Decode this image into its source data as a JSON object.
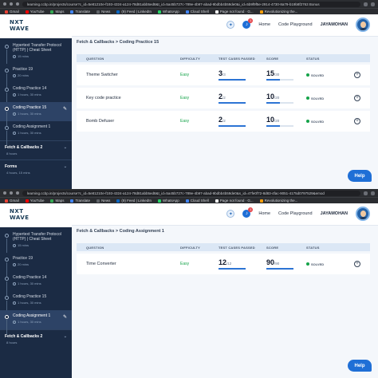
{
  "browser": {
    "url_top": "learning.ccbp.in/projects/course?c_id=5e81210e-f193-4324-a124-78d81abb5ed8&t_id=5a45b727c-789e-4b97-abad-9bdbb4b59de0&i_id=5b9f9f5e-2914-4730-8a79-b19b8f2763 Bonus",
    "url_bottom": "learning.ccbp.in/projects/course?c_id=5e81210e-f193-4324-a124-78d81abb5ed8&t_id=5a45b727c-789e-4b97-abad-9bdbb4b59de0&s_id=47fe0f72-8d83-4fac-9051-4175d0797529&emod",
    "bookmarks": [
      {
        "label": "Gmail",
        "color": "#ea4335"
      },
      {
        "label": "YouTube",
        "color": "#ff0000"
      },
      {
        "label": "Maps",
        "color": "#34a853"
      },
      {
        "label": "Translate",
        "color": "#4285f4"
      },
      {
        "label": "News",
        "color": "#5f6368"
      },
      {
        "label": "(9) Feed | LinkedIn",
        "color": "#0a66c2"
      },
      {
        "label": "WhatsApp",
        "color": "#25d366"
      },
      {
        "label": "Cloud Shell",
        "color": "#4285f4"
      },
      {
        "label": "Page not found · G...",
        "color": "#ffffff"
      },
      {
        "label": "Revolutionizing the...",
        "color": "#f59e0b"
      }
    ]
  },
  "logo": {
    "line1": "NXT",
    "line2": "WAVE"
  },
  "header": {
    "home": "Home",
    "code_playground": "Code Playground",
    "user": "JAYAMOHAN",
    "notification_count": "1"
  },
  "columns": {
    "question": "QUESTION",
    "difficulty": "DIFFICULTY",
    "test_cases": "TEST CASES PASSED",
    "score": "SCORE",
    "status": "STATUS"
  },
  "help": "Help",
  "top": {
    "breadcrumb": "Fetch & Callbacks > Coding Practice 15",
    "sidebar": [
      {
        "title": "Hypertext Transfer Protocol",
        "title2": "(HTTP) | Cheat Sheet",
        "meta": "15 mins"
      },
      {
        "title": "Practice 19",
        "meta": "20 mins"
      },
      {
        "title": "Coding Practice 14",
        "meta": "1 hours, 30 mins"
      },
      {
        "title": "Coding Practice 15",
        "meta": "1 hours, 30 mins",
        "active": true
      },
      {
        "title": "Coding Assignment 1",
        "meta": "1 hours, 30 mins"
      }
    ],
    "sections": [
      {
        "title": "Fetch & Callbacks 2",
        "meta": "8 hours"
      },
      {
        "title": "Forms",
        "meta": "4 hours, 15 mins"
      }
    ],
    "rows": [
      {
        "question": "Theme Switcher",
        "difficulty": "Easy",
        "passed": "3",
        "total": "/3",
        "score": "15",
        "score_total": "/30",
        "score_fraction": 0.5,
        "status": "SOLVED"
      },
      {
        "question": "Key code practice",
        "difficulty": "Easy",
        "passed": "2",
        "total": "/2",
        "score": "10",
        "score_total": "/20",
        "score_fraction": 0.5,
        "status": "SOLVED"
      },
      {
        "question": "Bomb Defuser",
        "difficulty": "Easy",
        "passed": "2",
        "total": "/2",
        "score": "10",
        "score_total": "/20",
        "score_fraction": 0.5,
        "status": "SOLVED"
      }
    ]
  },
  "bottom": {
    "breadcrumb": "Fetch & Callbacks > Coding Assignment 1",
    "sidebar": [
      {
        "title": "Hypertext Transfer Protocol",
        "title2": "(HTTP) | Cheat Sheet",
        "meta": "15 mins"
      },
      {
        "title": "Practice 19",
        "meta": "20 mins"
      },
      {
        "title": "Coding Practice 14",
        "meta": "1 hours, 30 mins"
      },
      {
        "title": "Coding Practice 15",
        "meta": "1 hours, 30 mins"
      },
      {
        "title": "Coding Assignment 1",
        "meta": "1 hours, 30 mins",
        "active": true
      }
    ],
    "sections": [
      {
        "title": "Fetch & Callbacks 2",
        "meta": "8 hours"
      }
    ],
    "rows": [
      {
        "question": "Time Converter",
        "difficulty": "Easy",
        "passed": "12",
        "total": "/12",
        "score": "90",
        "score_total": "/90",
        "score_fraction": 1.0,
        "status": "SOLVED"
      }
    ]
  }
}
